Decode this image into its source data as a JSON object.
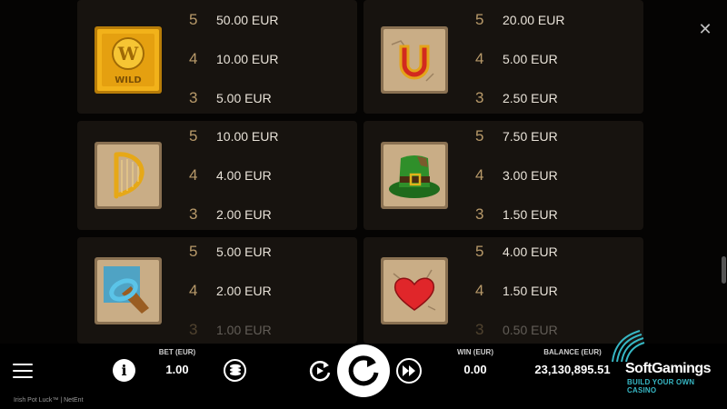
{
  "paytable": {
    "cards": [
      {
        "symbol": "wild-icon",
        "symbol_text": "WILD",
        "rows": [
          {
            "count": "5",
            "amount": "50.00 EUR"
          },
          {
            "count": "4",
            "amount": "10.00 EUR"
          },
          {
            "count": "3",
            "amount": "5.00 EUR"
          }
        ]
      },
      {
        "symbol": "horseshoe-icon",
        "rows": [
          {
            "count": "5",
            "amount": "20.00 EUR"
          },
          {
            "count": "4",
            "amount": "5.00 EUR"
          },
          {
            "count": "3",
            "amount": "2.50 EUR"
          }
        ]
      },
      {
        "symbol": "harp-icon",
        "rows": [
          {
            "count": "5",
            "amount": "10.00 EUR"
          },
          {
            "count": "4",
            "amount": "4.00 EUR"
          },
          {
            "count": "3",
            "amount": "2.00 EUR"
          }
        ]
      },
      {
        "symbol": "leprechaun-hat-icon",
        "rows": [
          {
            "count": "5",
            "amount": "7.50 EUR"
          },
          {
            "count": "4",
            "amount": "3.00 EUR"
          },
          {
            "count": "3",
            "amount": "1.50 EUR"
          }
        ]
      },
      {
        "symbol": "pipe-icon",
        "rows": [
          {
            "count": "5",
            "amount": "5.00 EUR"
          },
          {
            "count": "4",
            "amount": "2.00 EUR"
          },
          {
            "count": "3",
            "amount": "1.00 EUR"
          }
        ]
      },
      {
        "symbol": "heart-icon",
        "rows": [
          {
            "count": "5",
            "amount": "4.00 EUR"
          },
          {
            "count": "4",
            "amount": "1.50 EUR"
          },
          {
            "count": "3",
            "amount": "0.50 EUR"
          }
        ]
      }
    ]
  },
  "close_glyph": "✕",
  "controls": {
    "info_glyph": "i",
    "bet_label": "BET (EUR)",
    "bet_value": "1.00",
    "win_label": "WIN (EUR)",
    "win_value": "0.00",
    "balance_label": "BALANCE (EUR)",
    "balance_value": "23,130,895.51"
  },
  "footer": {
    "text": "Irish Pot Luck™  |  NetEnt"
  },
  "watermark": {
    "name": "SoftGamings",
    "tagline": "BUILD YOUR OWN CASINO"
  },
  "colors": {
    "card_bg": "#17130f",
    "count_gold": "#b89a6a",
    "tile_stone": "#c9ad86",
    "watermark_teal": "#37b7c4"
  }
}
